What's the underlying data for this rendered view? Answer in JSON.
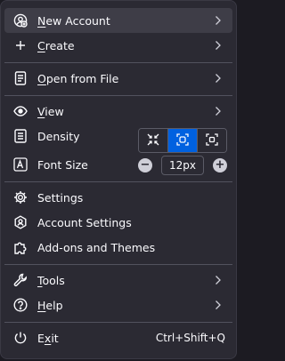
{
  "menu": {
    "items": [
      {
        "key": "new_account",
        "label": "New Account",
        "underline": "N",
        "icon": "new-account-icon",
        "submenu": true
      },
      {
        "key": "create",
        "label": "Create",
        "underline": "C",
        "icon": "plus-icon",
        "submenu": true
      },
      {
        "key": "open_from_file",
        "label": "Open from File",
        "underline": "O",
        "icon": "open-file-icon",
        "submenu": true
      },
      {
        "key": "view",
        "label": "View",
        "underline": "V",
        "icon": "eye-icon",
        "submenu": true
      },
      {
        "key": "density",
        "label": "Density",
        "icon": "density-icon"
      },
      {
        "key": "font_size",
        "label": "Font Size",
        "icon": "font-size-icon"
      },
      {
        "key": "settings",
        "label": "Settings",
        "icon": "gear-icon"
      },
      {
        "key": "account_settings",
        "label": "Account Settings",
        "icon": "account-settings-icon"
      },
      {
        "key": "addons",
        "label": "Add-ons and Themes",
        "icon": "puzzle-icon"
      },
      {
        "key": "tools",
        "label": "Tools",
        "underline": "T",
        "icon": "wrench-icon",
        "submenu": true
      },
      {
        "key": "help",
        "label": "Help",
        "underline": "H",
        "icon": "help-icon",
        "submenu": true
      },
      {
        "key": "exit",
        "label": "Exit",
        "underline": "x",
        "icon": "power-icon",
        "shortcut": "Ctrl+Shift+Q"
      }
    ],
    "density_options": [
      "compact",
      "normal",
      "touch"
    ],
    "density_selected": "normal",
    "font_size": "12px",
    "colors": {
      "background": "#2b2a33",
      "hover": "#3e3d47",
      "accent": "#0061e0",
      "text": "#fbfbfe"
    }
  }
}
